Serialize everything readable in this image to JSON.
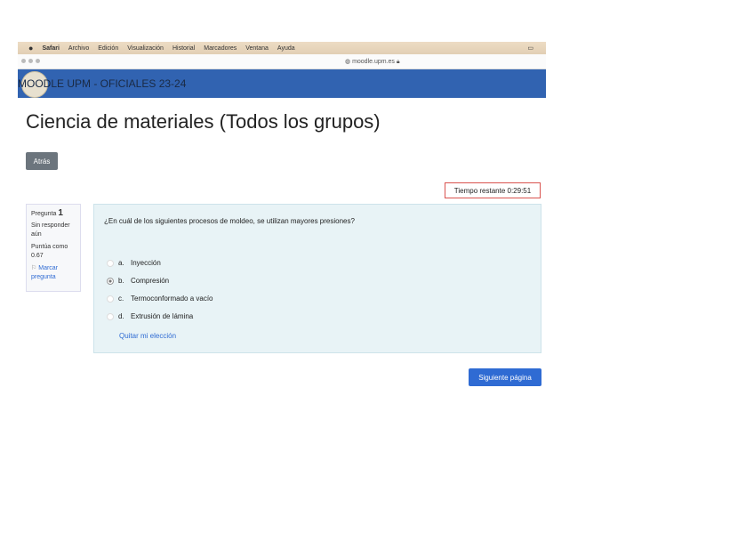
{
  "menubar": {
    "items": [
      "Safari",
      "Archivo",
      "Edición",
      "Visualización",
      "Historial",
      "Marcadores",
      "Ventana",
      "Ayuda"
    ]
  },
  "browser": {
    "url": "moodle.upm.es"
  },
  "site": {
    "name": "MOODLE UPM - OFICIALES 23-24"
  },
  "page": {
    "title": "Ciencia de materiales (Todos los grupos)",
    "back_label": "Atrás",
    "timer": "Tiempo restante 0:29:51",
    "next_label": "Siguiente página"
  },
  "info": {
    "question_label": "Pregunta",
    "question_number": "1",
    "status": "Sin responder aún",
    "score": "Puntúa como 0.67",
    "flag": "Marcar pregunta"
  },
  "question": {
    "text": "¿En cuál de los siguientes procesos de moldeo, se utilizan mayores presiones?",
    "options": [
      {
        "letter": "a.",
        "text": "Inyección",
        "selected": false
      },
      {
        "letter": "b.",
        "text": "Compresión",
        "selected": true
      },
      {
        "letter": "c.",
        "text": "Termoconformado a vacío",
        "selected": false
      },
      {
        "letter": "d.",
        "text": "Extrusión de lámina",
        "selected": false
      }
    ],
    "clear_label": "Quitar mi elección"
  }
}
